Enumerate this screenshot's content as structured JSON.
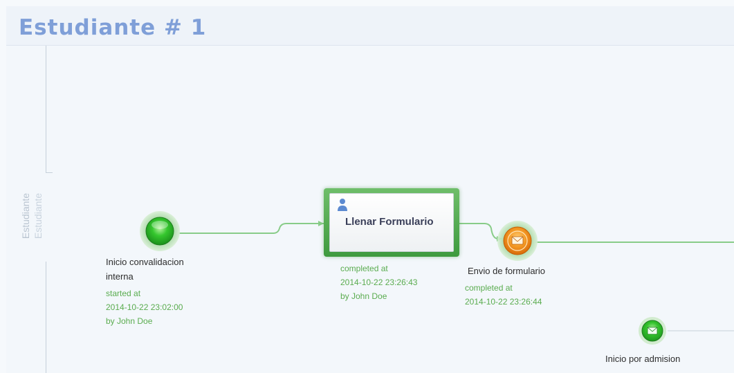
{
  "header": {
    "title": "Estudiante # 1"
  },
  "lane": {
    "label_outer": "Estudiante",
    "label_inner": "Estudiante"
  },
  "nodes": {
    "start_event": {
      "label_line1": "Inicio convalidacion",
      "label_line2": "interna",
      "status_label": "started at",
      "status_time": "2014-10-22 23:02:00",
      "status_user": "by John Doe",
      "state": "started",
      "icon": "green-circle-icon"
    },
    "user_task": {
      "title": "Llenar Formulario",
      "status_label": "completed at",
      "status_time": "2014-10-22 23:26:43",
      "status_user": "by John Doe",
      "state": "completed",
      "icon": "user-icon"
    },
    "message_event": {
      "label": "Envio de formulario",
      "status_label": "completed at",
      "status_time": "2014-10-22 23:26:44",
      "state": "completed",
      "icon": "envelope-icon"
    },
    "message_start_event": {
      "label": "Inicio por admision",
      "icon": "envelope-icon"
    }
  },
  "colors": {
    "title": "#7f9fd8",
    "status_text": "#5aac4f",
    "flow_line": "#88cc88",
    "event_green": "#2fae2f",
    "event_orange": "#f08a1c"
  }
}
